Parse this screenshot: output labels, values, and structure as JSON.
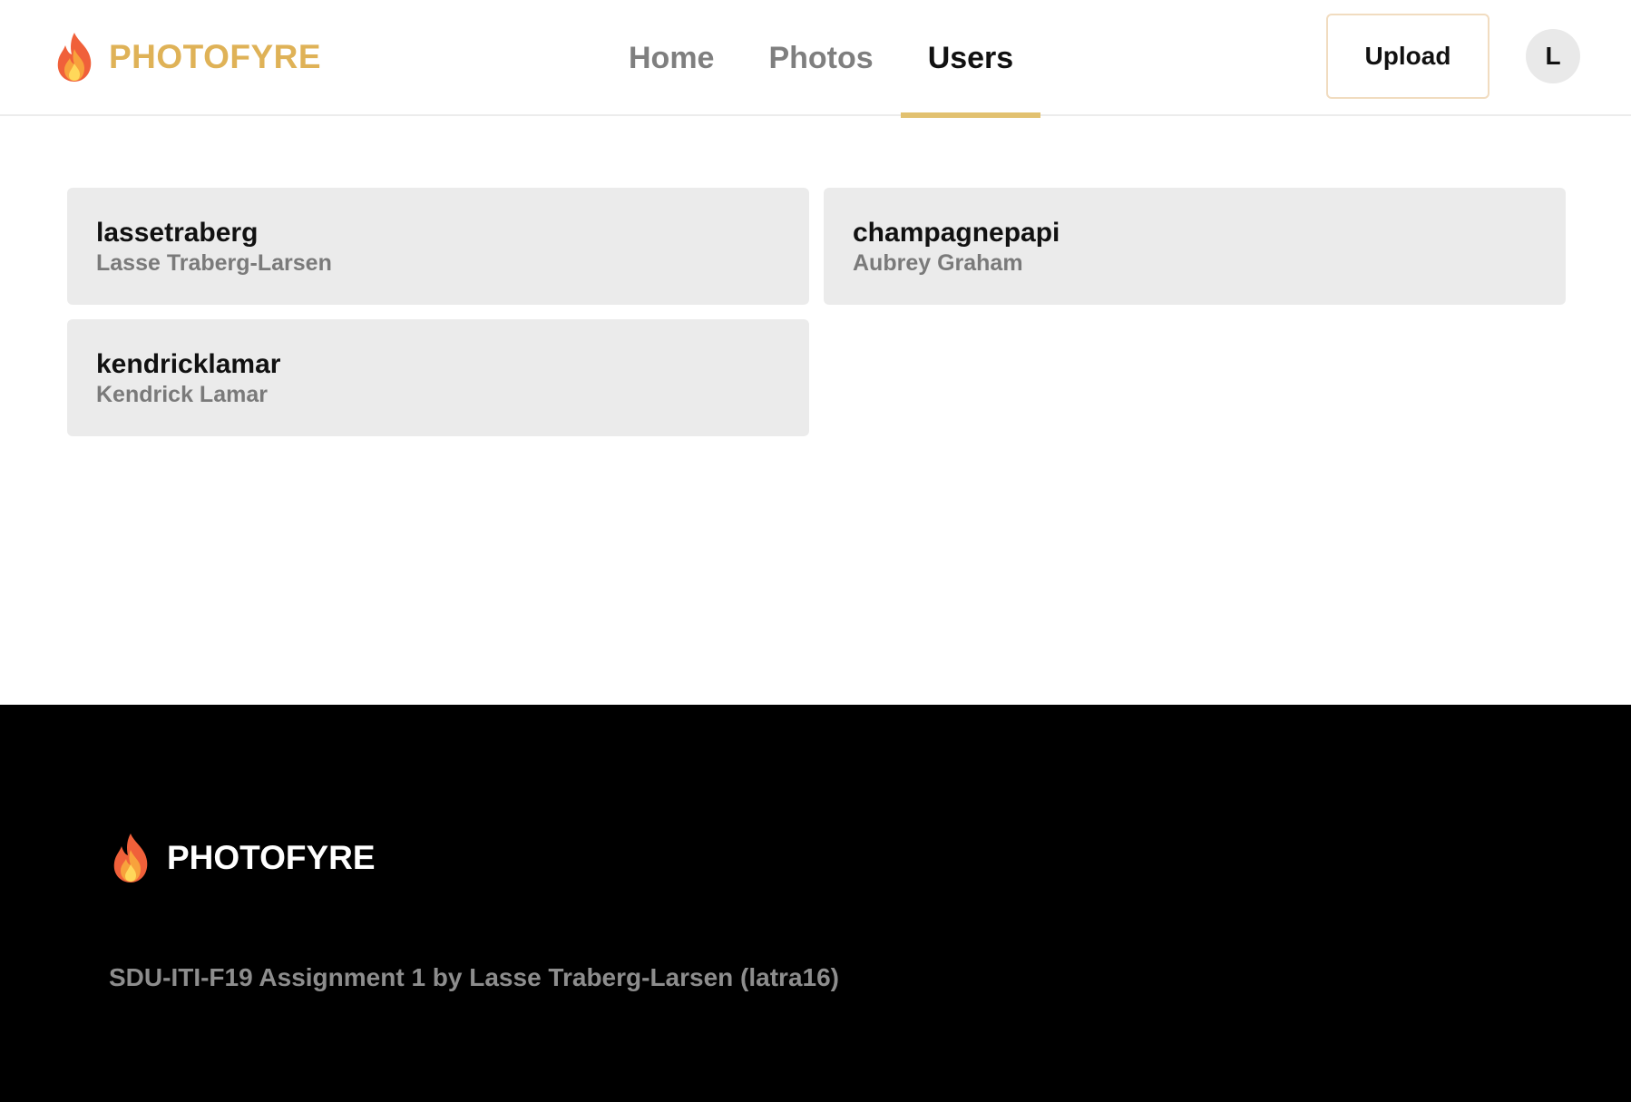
{
  "header": {
    "brand": "PHOTOFYRE",
    "logo_icon": "flame-icon",
    "nav": [
      {
        "label": "Home",
        "active": false
      },
      {
        "label": "Photos",
        "active": false
      },
      {
        "label": "Users",
        "active": true
      }
    ],
    "upload_label": "Upload",
    "avatar_initial": "L"
  },
  "users": [
    {
      "username": "lassetraberg",
      "name": "Lasse Traberg-Larsen"
    },
    {
      "username": "champagnepapi",
      "name": "Aubrey Graham"
    },
    {
      "username": "kendricklamar",
      "name": "Kendrick Lamar"
    }
  ],
  "footer": {
    "brand": "PHOTOFYRE",
    "logo_icon": "flame-icon",
    "credit": "SDU-ITI-F19 Assignment 1 by Lasse Traberg-Larsen (latra16)"
  },
  "colors": {
    "brand_gold": "#dfb257",
    "active_underline": "#e2c170",
    "card_bg": "#ebebeb",
    "footer_bg": "#000000"
  }
}
